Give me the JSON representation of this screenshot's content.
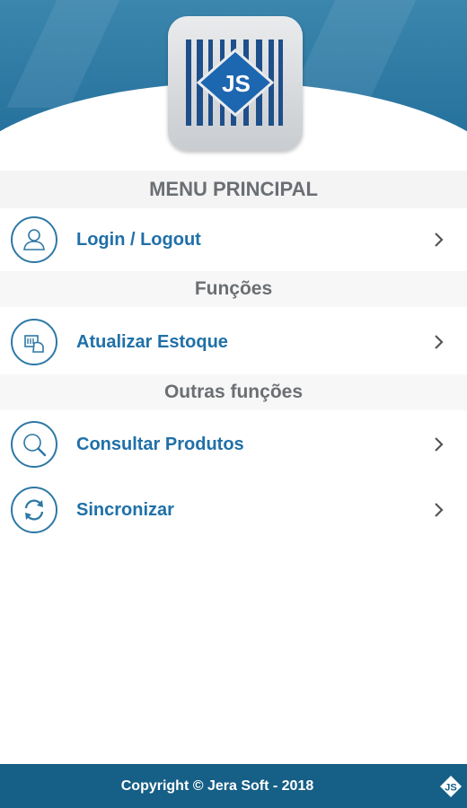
{
  "header": {
    "logo_name": "barcode-js-logo-icon",
    "logo_text": "JS"
  },
  "sections": {
    "main_title": "MENU PRINCIPAL",
    "functions_title": "Funções",
    "other_title": "Outras funções"
  },
  "menu": {
    "login": {
      "label": "Login / Logout",
      "icon": "user-icon"
    },
    "stock": {
      "label": "Atualizar Estoque",
      "icon": "scanner-box-icon"
    },
    "query": {
      "label": "Consultar Produtos",
      "icon": "magnifier-icon"
    },
    "sync": {
      "label": "Sincronizar",
      "icon": "sync-icon"
    }
  },
  "footer": {
    "copyright": "Copyright © Jera Soft - 2018",
    "logo_text": "JS"
  },
  "colors": {
    "accent": "#1f70a8",
    "header_blue": "#2f7aa4",
    "footer_blue": "#165f86",
    "section_text": "#6b6f73"
  }
}
